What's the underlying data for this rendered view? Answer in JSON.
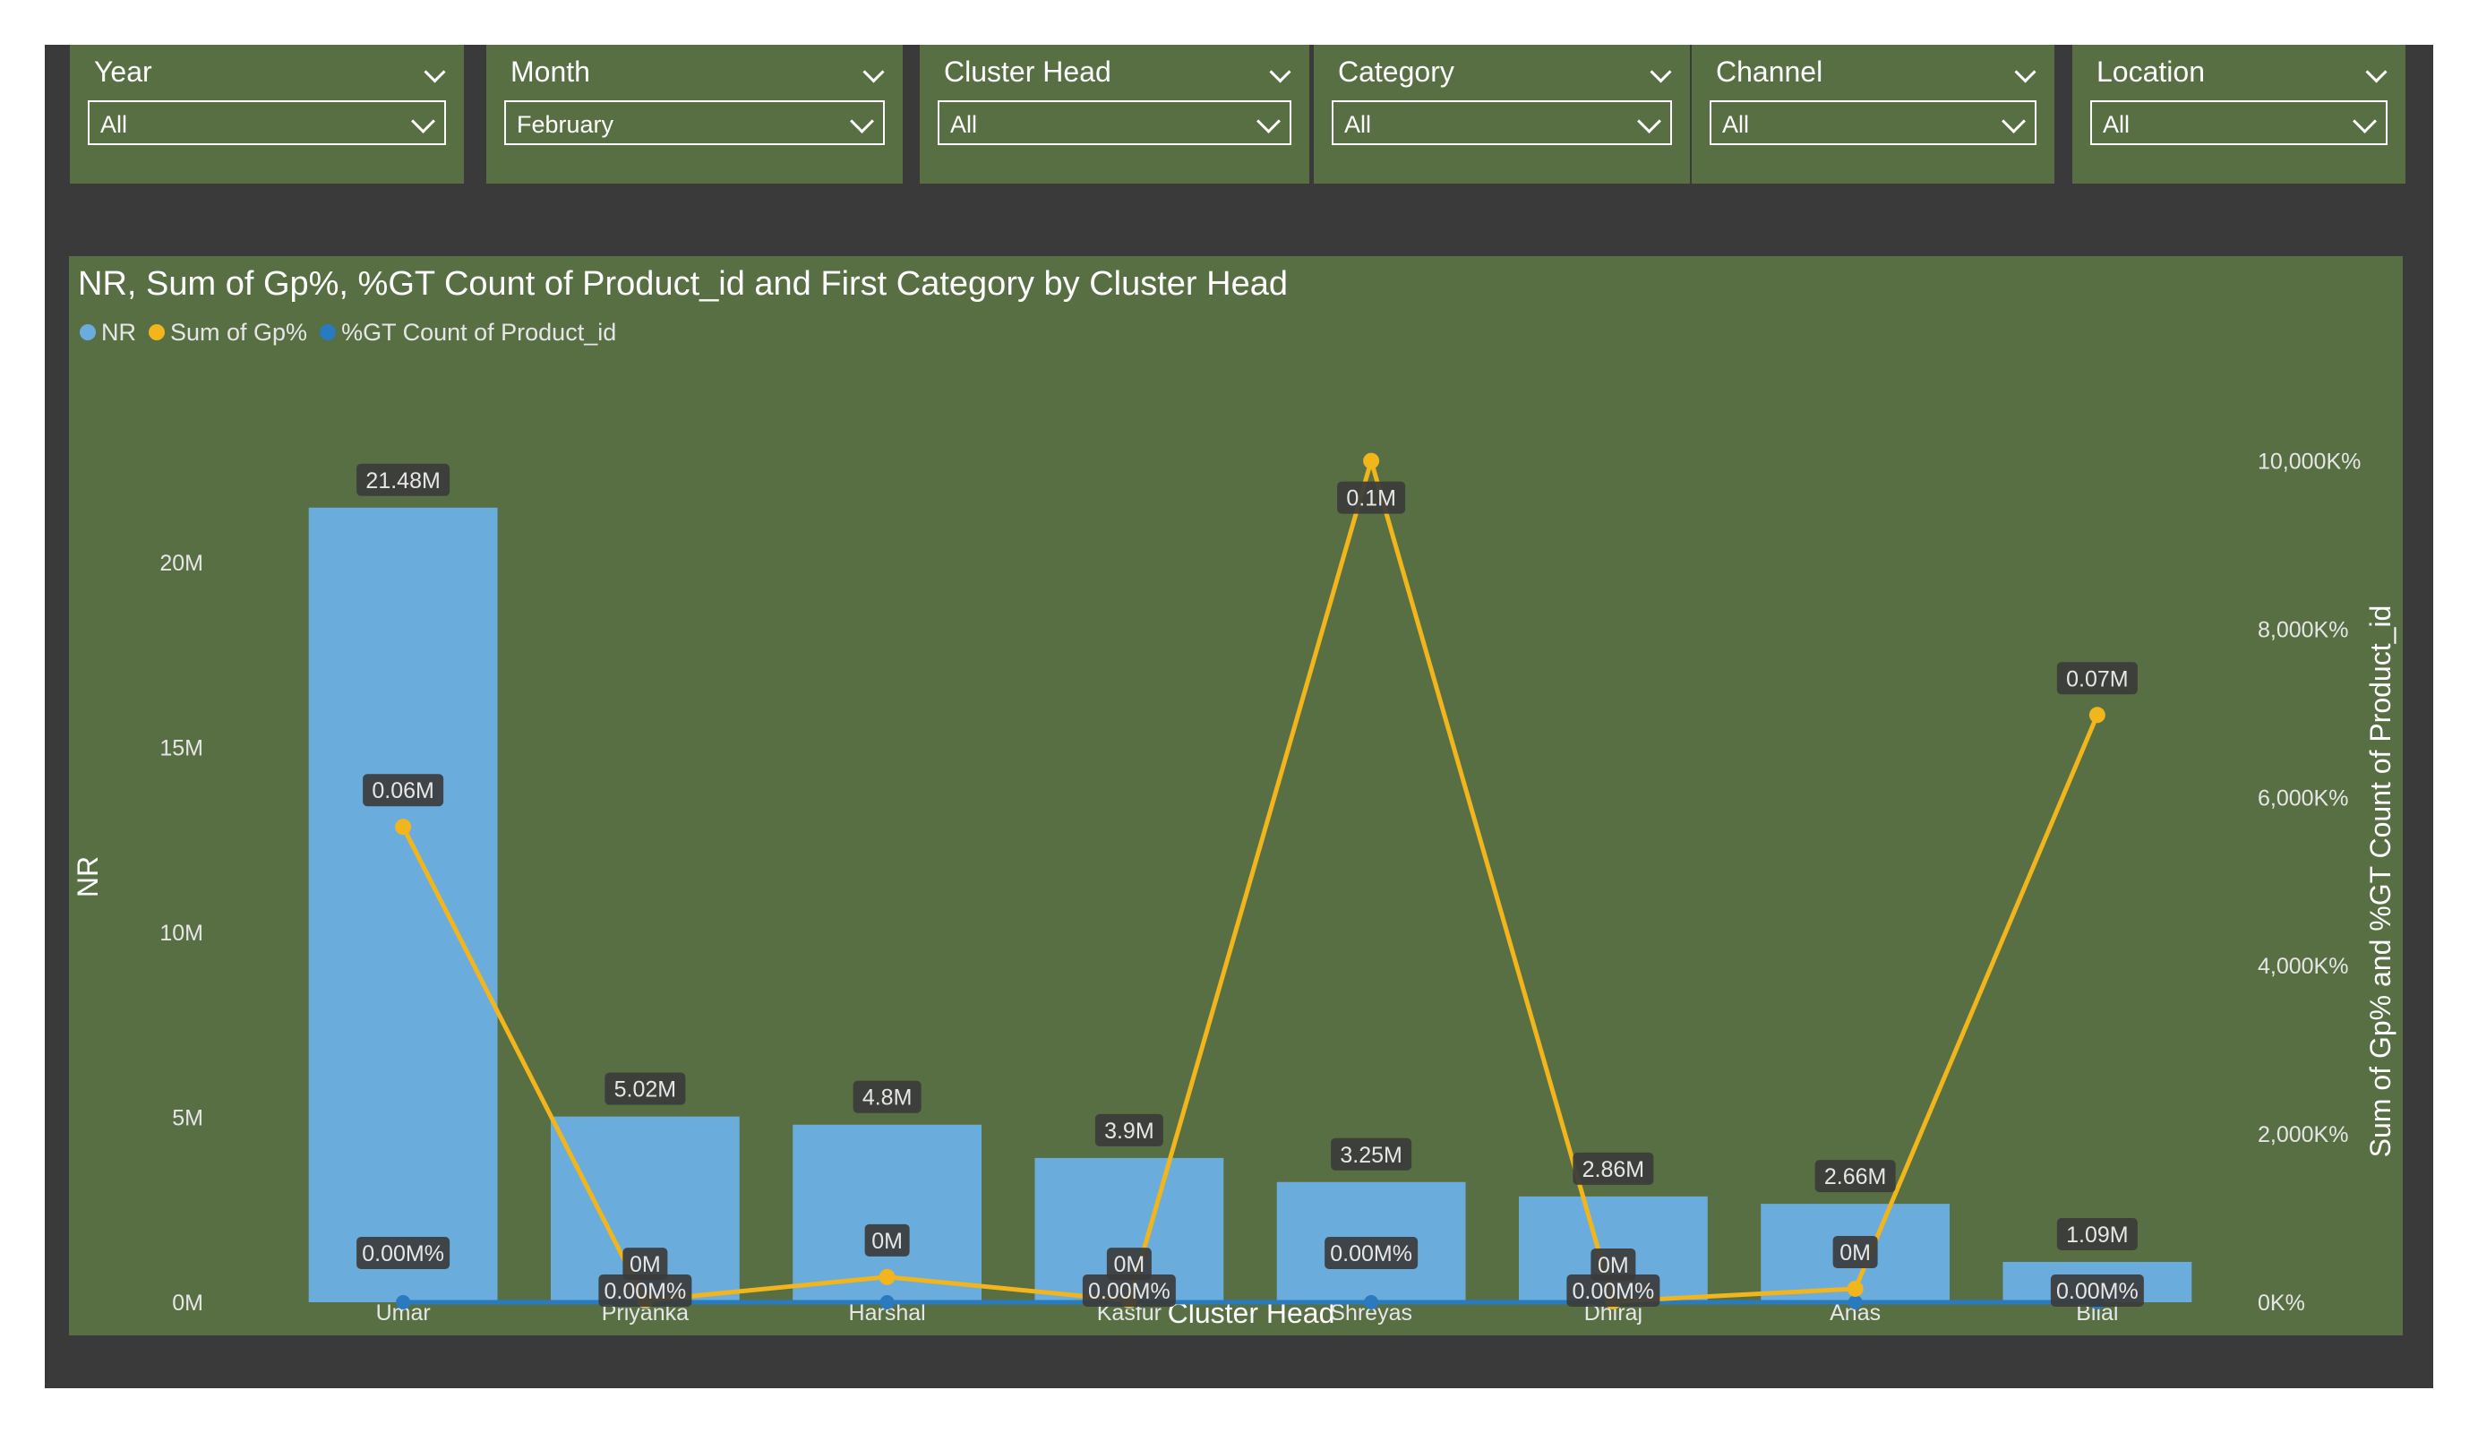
{
  "slicers": [
    {
      "title": "Year",
      "value": "All"
    },
    {
      "title": "Month",
      "value": "February"
    },
    {
      "title": "Cluster Head",
      "value": "All"
    },
    {
      "title": "Category",
      "value": "All"
    },
    {
      "title": "Channel",
      "value": "All"
    },
    {
      "title": "Location",
      "value": "All"
    }
  ],
  "colors": {
    "background": "#3a3a3a",
    "panel": "#586f44",
    "nr_bar": "#6aaddd",
    "gp_line": "#f2b51c",
    "gt_line": "#2a7ac0",
    "label_bg": "#3b3b3b"
  },
  "chart_data": {
    "type": "bar",
    "title": "NR, Sum of Gp%, %GT Count of Product_id and First Category by Cluster Head",
    "xlabel": "Cluster Head",
    "ylabel": "NR",
    "y2label": "Sum of Gp% and %GT Count of Product_id",
    "ylim": [
      0,
      23000000
    ],
    "y2lim": [
      0,
      10400000
    ],
    "yticks": [
      {
        "value": 0,
        "label": "0M"
      },
      {
        "value": 5000000,
        "label": "5M"
      },
      {
        "value": 10000000,
        "label": "10M"
      },
      {
        "value": 15000000,
        "label": "15M"
      },
      {
        "value": 20000000,
        "label": "20M"
      }
    ],
    "y2ticks": [
      {
        "value": 0,
        "label": "0K%"
      },
      {
        "value": 2000000,
        "label": "2,000K%"
      },
      {
        "value": 4000000,
        "label": "4,000K%"
      },
      {
        "value": 6000000,
        "label": "6,000K%"
      },
      {
        "value": 8000000,
        "label": "8,000K%"
      },
      {
        "value": 10000000,
        "label": "10,000K%"
      }
    ],
    "legend_position": "top-left",
    "grid": false,
    "categories": [
      "Umar",
      "Priyanka",
      "Harshal",
      "Kasfur",
      "Shreyas",
      "Dhiraj",
      "Anas",
      "Bilal"
    ],
    "series": [
      {
        "name": "NR",
        "kind": "bar",
        "axis": "left",
        "values": [
          21480000,
          5020000,
          4800000,
          3900000,
          3250000,
          2860000,
          2660000,
          1090000
        ],
        "labels": [
          "21.48M",
          "5.02M",
          "4.8M",
          "3.9M",
          "3.25M",
          "2.86M",
          "2.66M",
          "1.09M"
        ]
      },
      {
        "name": "Sum of Gp%",
        "kind": "line",
        "axis": "right",
        "values": [
          5650000,
          20000,
          300000,
          20000,
          10000000,
          10000,
          160000,
          6980000
        ],
        "labels": [
          "0.06M",
          "0M",
          "0M",
          "0M",
          "0.1M",
          "0M",
          "0M",
          "0.07M"
        ]
      },
      {
        "name": "%GT Count of Product_id",
        "kind": "line",
        "axis": "right",
        "values": [
          0,
          0,
          0,
          0,
          0,
          0,
          0,
          0
        ],
        "labels": [
          "0.00M%",
          "0.00M%",
          "",
          "0.00M%",
          "0.00M%",
          "0.00M%",
          "",
          "0.00M%"
        ]
      }
    ]
  }
}
